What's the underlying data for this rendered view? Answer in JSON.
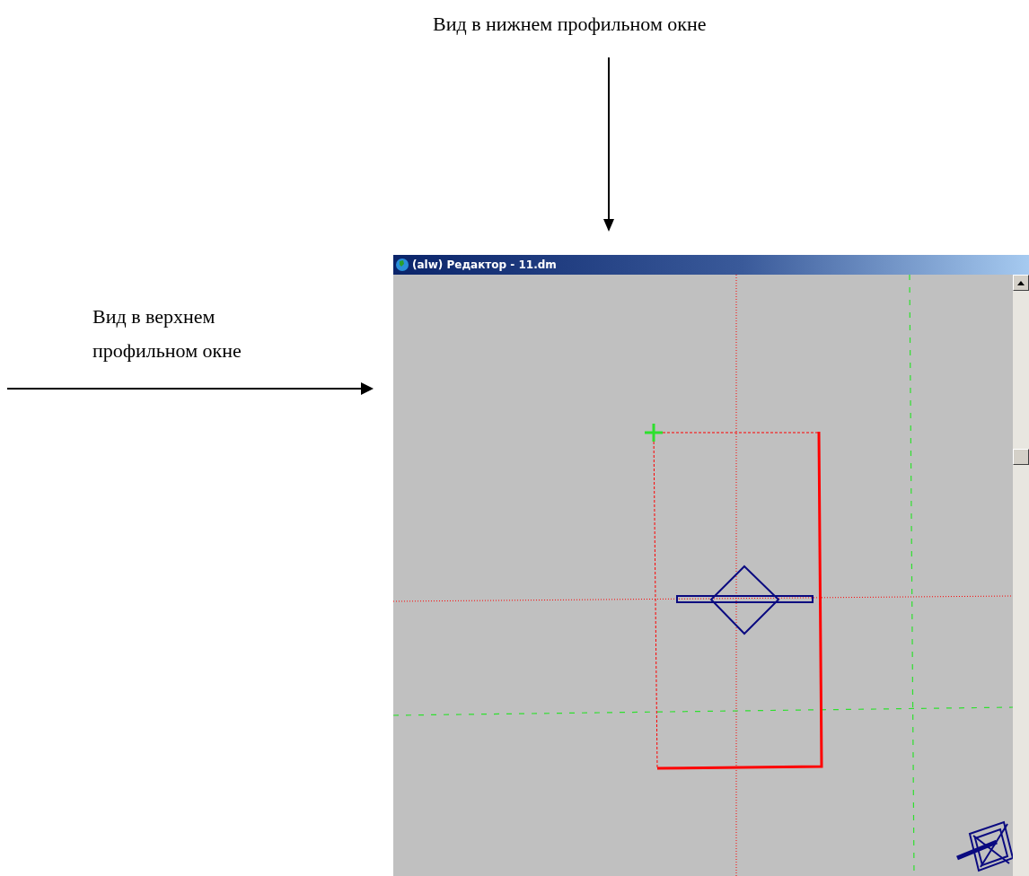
{
  "top_caption": "Вид в нижнем профильном окне",
  "left_caption": "Вид в верхнем профильном окне",
  "window": {
    "title": "(alw) Редактор - 11.dm"
  }
}
